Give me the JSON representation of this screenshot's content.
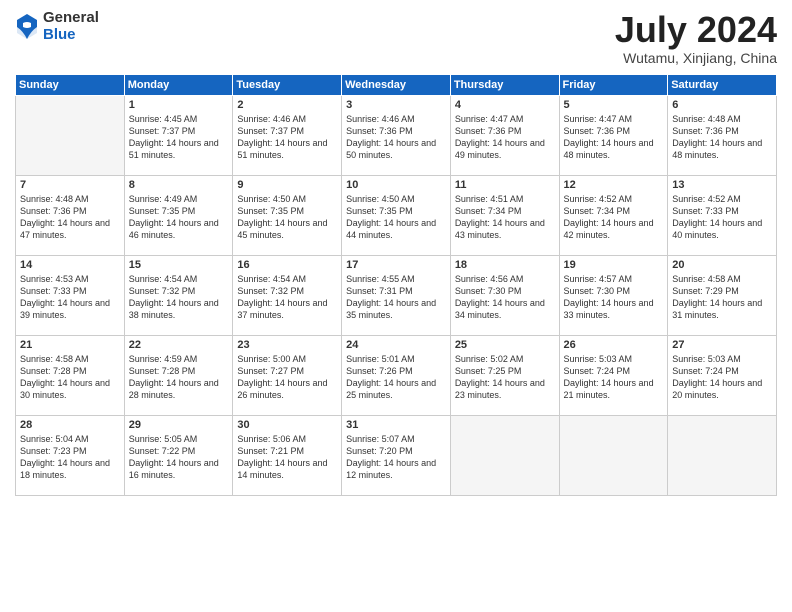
{
  "header": {
    "logo_general": "General",
    "logo_blue": "Blue",
    "title": "July 2024",
    "location": "Wutamu, Xinjiang, China"
  },
  "weekdays": [
    "Sunday",
    "Monday",
    "Tuesday",
    "Wednesday",
    "Thursday",
    "Friday",
    "Saturday"
  ],
  "weeks": [
    [
      {
        "day": "",
        "sunrise": "",
        "sunset": "",
        "daylight": ""
      },
      {
        "day": "1",
        "sunrise": "Sunrise: 4:45 AM",
        "sunset": "Sunset: 7:37 PM",
        "daylight": "Daylight: 14 hours and 51 minutes."
      },
      {
        "day": "2",
        "sunrise": "Sunrise: 4:46 AM",
        "sunset": "Sunset: 7:37 PM",
        "daylight": "Daylight: 14 hours and 51 minutes."
      },
      {
        "day": "3",
        "sunrise": "Sunrise: 4:46 AM",
        "sunset": "Sunset: 7:36 PM",
        "daylight": "Daylight: 14 hours and 50 minutes."
      },
      {
        "day": "4",
        "sunrise": "Sunrise: 4:47 AM",
        "sunset": "Sunset: 7:36 PM",
        "daylight": "Daylight: 14 hours and 49 minutes."
      },
      {
        "day": "5",
        "sunrise": "Sunrise: 4:47 AM",
        "sunset": "Sunset: 7:36 PM",
        "daylight": "Daylight: 14 hours and 48 minutes."
      },
      {
        "day": "6",
        "sunrise": "Sunrise: 4:48 AM",
        "sunset": "Sunset: 7:36 PM",
        "daylight": "Daylight: 14 hours and 48 minutes."
      }
    ],
    [
      {
        "day": "7",
        "sunrise": "Sunrise: 4:48 AM",
        "sunset": "Sunset: 7:36 PM",
        "daylight": "Daylight: 14 hours and 47 minutes."
      },
      {
        "day": "8",
        "sunrise": "Sunrise: 4:49 AM",
        "sunset": "Sunset: 7:35 PM",
        "daylight": "Daylight: 14 hours and 46 minutes."
      },
      {
        "day": "9",
        "sunrise": "Sunrise: 4:50 AM",
        "sunset": "Sunset: 7:35 PM",
        "daylight": "Daylight: 14 hours and 45 minutes."
      },
      {
        "day": "10",
        "sunrise": "Sunrise: 4:50 AM",
        "sunset": "Sunset: 7:35 PM",
        "daylight": "Daylight: 14 hours and 44 minutes."
      },
      {
        "day": "11",
        "sunrise": "Sunrise: 4:51 AM",
        "sunset": "Sunset: 7:34 PM",
        "daylight": "Daylight: 14 hours and 43 minutes."
      },
      {
        "day": "12",
        "sunrise": "Sunrise: 4:52 AM",
        "sunset": "Sunset: 7:34 PM",
        "daylight": "Daylight: 14 hours and 42 minutes."
      },
      {
        "day": "13",
        "sunrise": "Sunrise: 4:52 AM",
        "sunset": "Sunset: 7:33 PM",
        "daylight": "Daylight: 14 hours and 40 minutes."
      }
    ],
    [
      {
        "day": "14",
        "sunrise": "Sunrise: 4:53 AM",
        "sunset": "Sunset: 7:33 PM",
        "daylight": "Daylight: 14 hours and 39 minutes."
      },
      {
        "day": "15",
        "sunrise": "Sunrise: 4:54 AM",
        "sunset": "Sunset: 7:32 PM",
        "daylight": "Daylight: 14 hours and 38 minutes."
      },
      {
        "day": "16",
        "sunrise": "Sunrise: 4:54 AM",
        "sunset": "Sunset: 7:32 PM",
        "daylight": "Daylight: 14 hours and 37 minutes."
      },
      {
        "day": "17",
        "sunrise": "Sunrise: 4:55 AM",
        "sunset": "Sunset: 7:31 PM",
        "daylight": "Daylight: 14 hours and 35 minutes."
      },
      {
        "day": "18",
        "sunrise": "Sunrise: 4:56 AM",
        "sunset": "Sunset: 7:30 PM",
        "daylight": "Daylight: 14 hours and 34 minutes."
      },
      {
        "day": "19",
        "sunrise": "Sunrise: 4:57 AM",
        "sunset": "Sunset: 7:30 PM",
        "daylight": "Daylight: 14 hours and 33 minutes."
      },
      {
        "day": "20",
        "sunrise": "Sunrise: 4:58 AM",
        "sunset": "Sunset: 7:29 PM",
        "daylight": "Daylight: 14 hours and 31 minutes."
      }
    ],
    [
      {
        "day": "21",
        "sunrise": "Sunrise: 4:58 AM",
        "sunset": "Sunset: 7:28 PM",
        "daylight": "Daylight: 14 hours and 30 minutes."
      },
      {
        "day": "22",
        "sunrise": "Sunrise: 4:59 AM",
        "sunset": "Sunset: 7:28 PM",
        "daylight": "Daylight: 14 hours and 28 minutes."
      },
      {
        "day": "23",
        "sunrise": "Sunrise: 5:00 AM",
        "sunset": "Sunset: 7:27 PM",
        "daylight": "Daylight: 14 hours and 26 minutes."
      },
      {
        "day": "24",
        "sunrise": "Sunrise: 5:01 AM",
        "sunset": "Sunset: 7:26 PM",
        "daylight": "Daylight: 14 hours and 25 minutes."
      },
      {
        "day": "25",
        "sunrise": "Sunrise: 5:02 AM",
        "sunset": "Sunset: 7:25 PM",
        "daylight": "Daylight: 14 hours and 23 minutes."
      },
      {
        "day": "26",
        "sunrise": "Sunrise: 5:03 AM",
        "sunset": "Sunset: 7:24 PM",
        "daylight": "Daylight: 14 hours and 21 minutes."
      },
      {
        "day": "27",
        "sunrise": "Sunrise: 5:03 AM",
        "sunset": "Sunset: 7:24 PM",
        "daylight": "Daylight: 14 hours and 20 minutes."
      }
    ],
    [
      {
        "day": "28",
        "sunrise": "Sunrise: 5:04 AM",
        "sunset": "Sunset: 7:23 PM",
        "daylight": "Daylight: 14 hours and 18 minutes."
      },
      {
        "day": "29",
        "sunrise": "Sunrise: 5:05 AM",
        "sunset": "Sunset: 7:22 PM",
        "daylight": "Daylight: 14 hours and 16 minutes."
      },
      {
        "day": "30",
        "sunrise": "Sunrise: 5:06 AM",
        "sunset": "Sunset: 7:21 PM",
        "daylight": "Daylight: 14 hours and 14 minutes."
      },
      {
        "day": "31",
        "sunrise": "Sunrise: 5:07 AM",
        "sunset": "Sunset: 7:20 PM",
        "daylight": "Daylight: 14 hours and 12 minutes."
      },
      {
        "day": "",
        "sunrise": "",
        "sunset": "",
        "daylight": ""
      },
      {
        "day": "",
        "sunrise": "",
        "sunset": "",
        "daylight": ""
      },
      {
        "day": "",
        "sunrise": "",
        "sunset": "",
        "daylight": ""
      }
    ]
  ]
}
